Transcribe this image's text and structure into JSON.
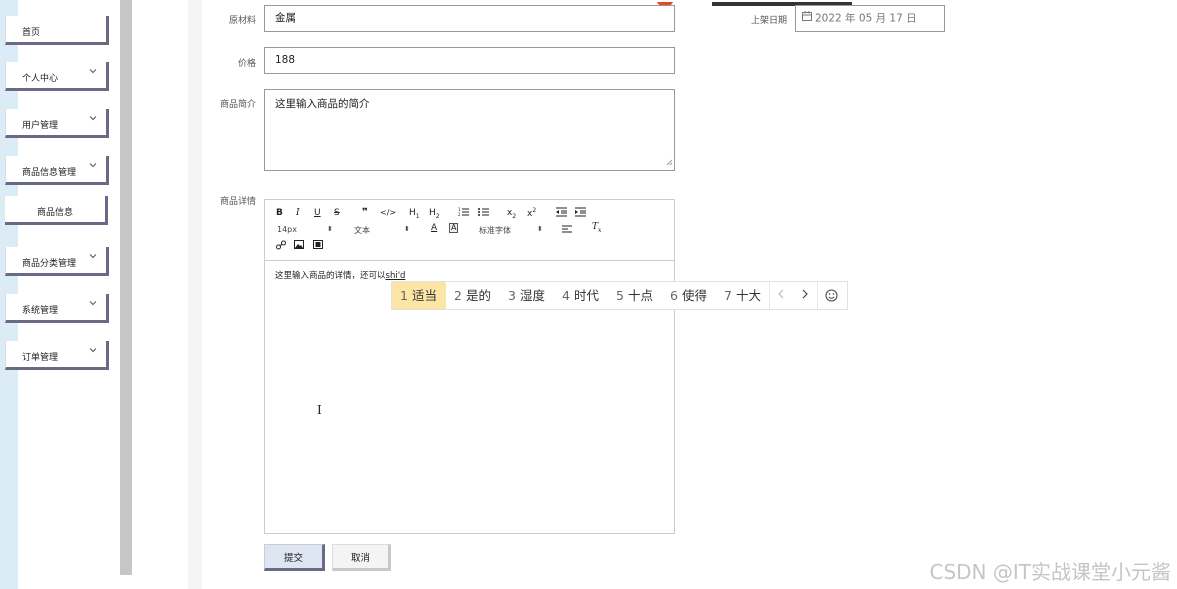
{
  "sidebar": {
    "items": [
      {
        "label": "首页",
        "has_chevron": false
      },
      {
        "label": "个人中心",
        "has_chevron": true
      },
      {
        "label": "用户管理",
        "has_chevron": true
      },
      {
        "label": "商品信息管理",
        "has_chevron": true
      },
      {
        "label": "商品信息",
        "has_chevron": false,
        "sub": true
      },
      {
        "label": "商品分类管理",
        "has_chevron": true
      },
      {
        "label": "系统管理",
        "has_chevron": true
      },
      {
        "label": "订单管理",
        "has_chevron": true
      }
    ]
  },
  "form": {
    "material_label": "原材料",
    "material_value": "金属",
    "date_label": "上架日期",
    "date_value": "2022 年 05 月 17 日",
    "price_label": "价格",
    "price_value": "188",
    "intro_label": "商品简介",
    "intro_value": "这里输入商品的简介",
    "detail_label": "商品详情",
    "detail_text": "这里输入商品的详情，还可以",
    "detail_typing": "shi'd"
  },
  "editor_toolbar": {
    "font_size": "14px",
    "text_style": "文本",
    "font_family": "标准字体"
  },
  "ime": {
    "candidates": [
      {
        "num": "1",
        "text": "适当"
      },
      {
        "num": "2",
        "text": "是的"
      },
      {
        "num": "3",
        "text": "湿度"
      },
      {
        "num": "4",
        "text": "时代"
      },
      {
        "num": "5",
        "text": "十点"
      },
      {
        "num": "6",
        "text": "使得"
      },
      {
        "num": "7",
        "text": "十大"
      }
    ]
  },
  "buttons": {
    "submit": "提交",
    "cancel": "取消"
  },
  "watermark": "CSDN @IT实战课堂小元酱",
  "colors": {
    "sidebar_edge": "#dcecf6",
    "menu_border": "#6a6a86",
    "ime_highlight": "#fde5a6"
  }
}
